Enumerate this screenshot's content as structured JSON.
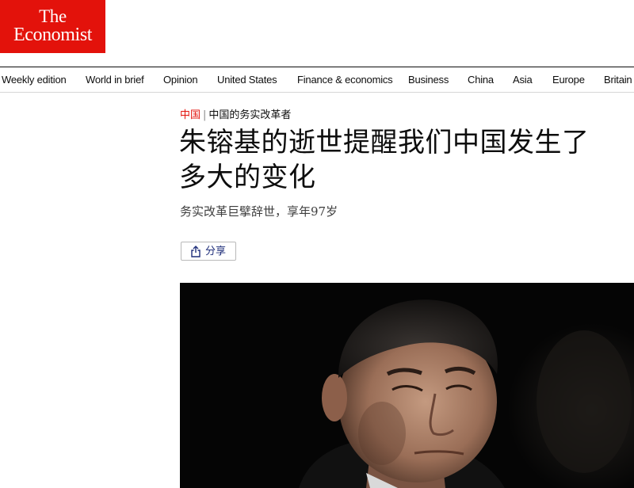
{
  "header": {
    "logo_line1": "The",
    "logo_line2": "Economist"
  },
  "nav": {
    "items": [
      "Weekly edition",
      "World in brief",
      "Opinion",
      "United States",
      "Finance & economics",
      "Business",
      "China",
      "Asia",
      "Europe",
      "Britain"
    ]
  },
  "article": {
    "section": "中国",
    "separator": "|",
    "theme": "中国的务实改革者",
    "headline_line1": "朱镕基的逝世提醒我们中国发生了",
    "headline_line2": "多大的变化",
    "subheadline": "务实改革巨擘辞世，享年97岁",
    "share_label": "分享"
  },
  "colors": {
    "brand_red": "#e3120b",
    "text": "#0d0d0d",
    "share_text": "#1f2e7a"
  },
  "icons": {
    "share": "share-icon"
  }
}
